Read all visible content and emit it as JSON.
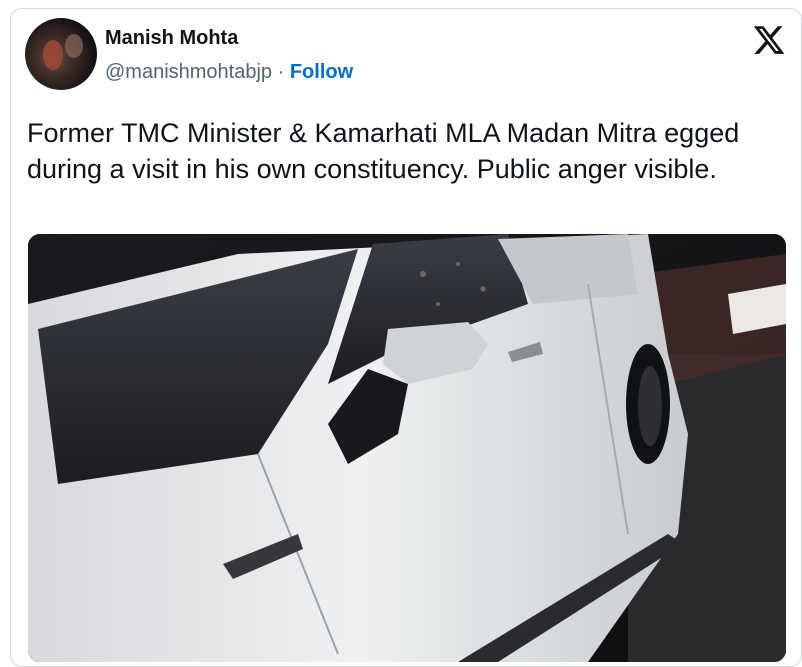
{
  "author": {
    "name": "Manish Mohta",
    "handle": "@manishmohtabjp",
    "separator": "·",
    "follow_label": "Follow"
  },
  "brand": {
    "icon": "x-logo-icon",
    "color": "#0f1419"
  },
  "tweet": {
    "text": "Former TMC Minister & Kamarhati MLA Madan Mitra egged during a visit in his own constituency. Public anger visible."
  },
  "media": {
    "type": "video-still",
    "description_icon": "car-image"
  },
  "colors": {
    "follow": "#006fd6",
    "text": "#0f1419",
    "secondary": "#536471",
    "border": "#cfd9de"
  }
}
